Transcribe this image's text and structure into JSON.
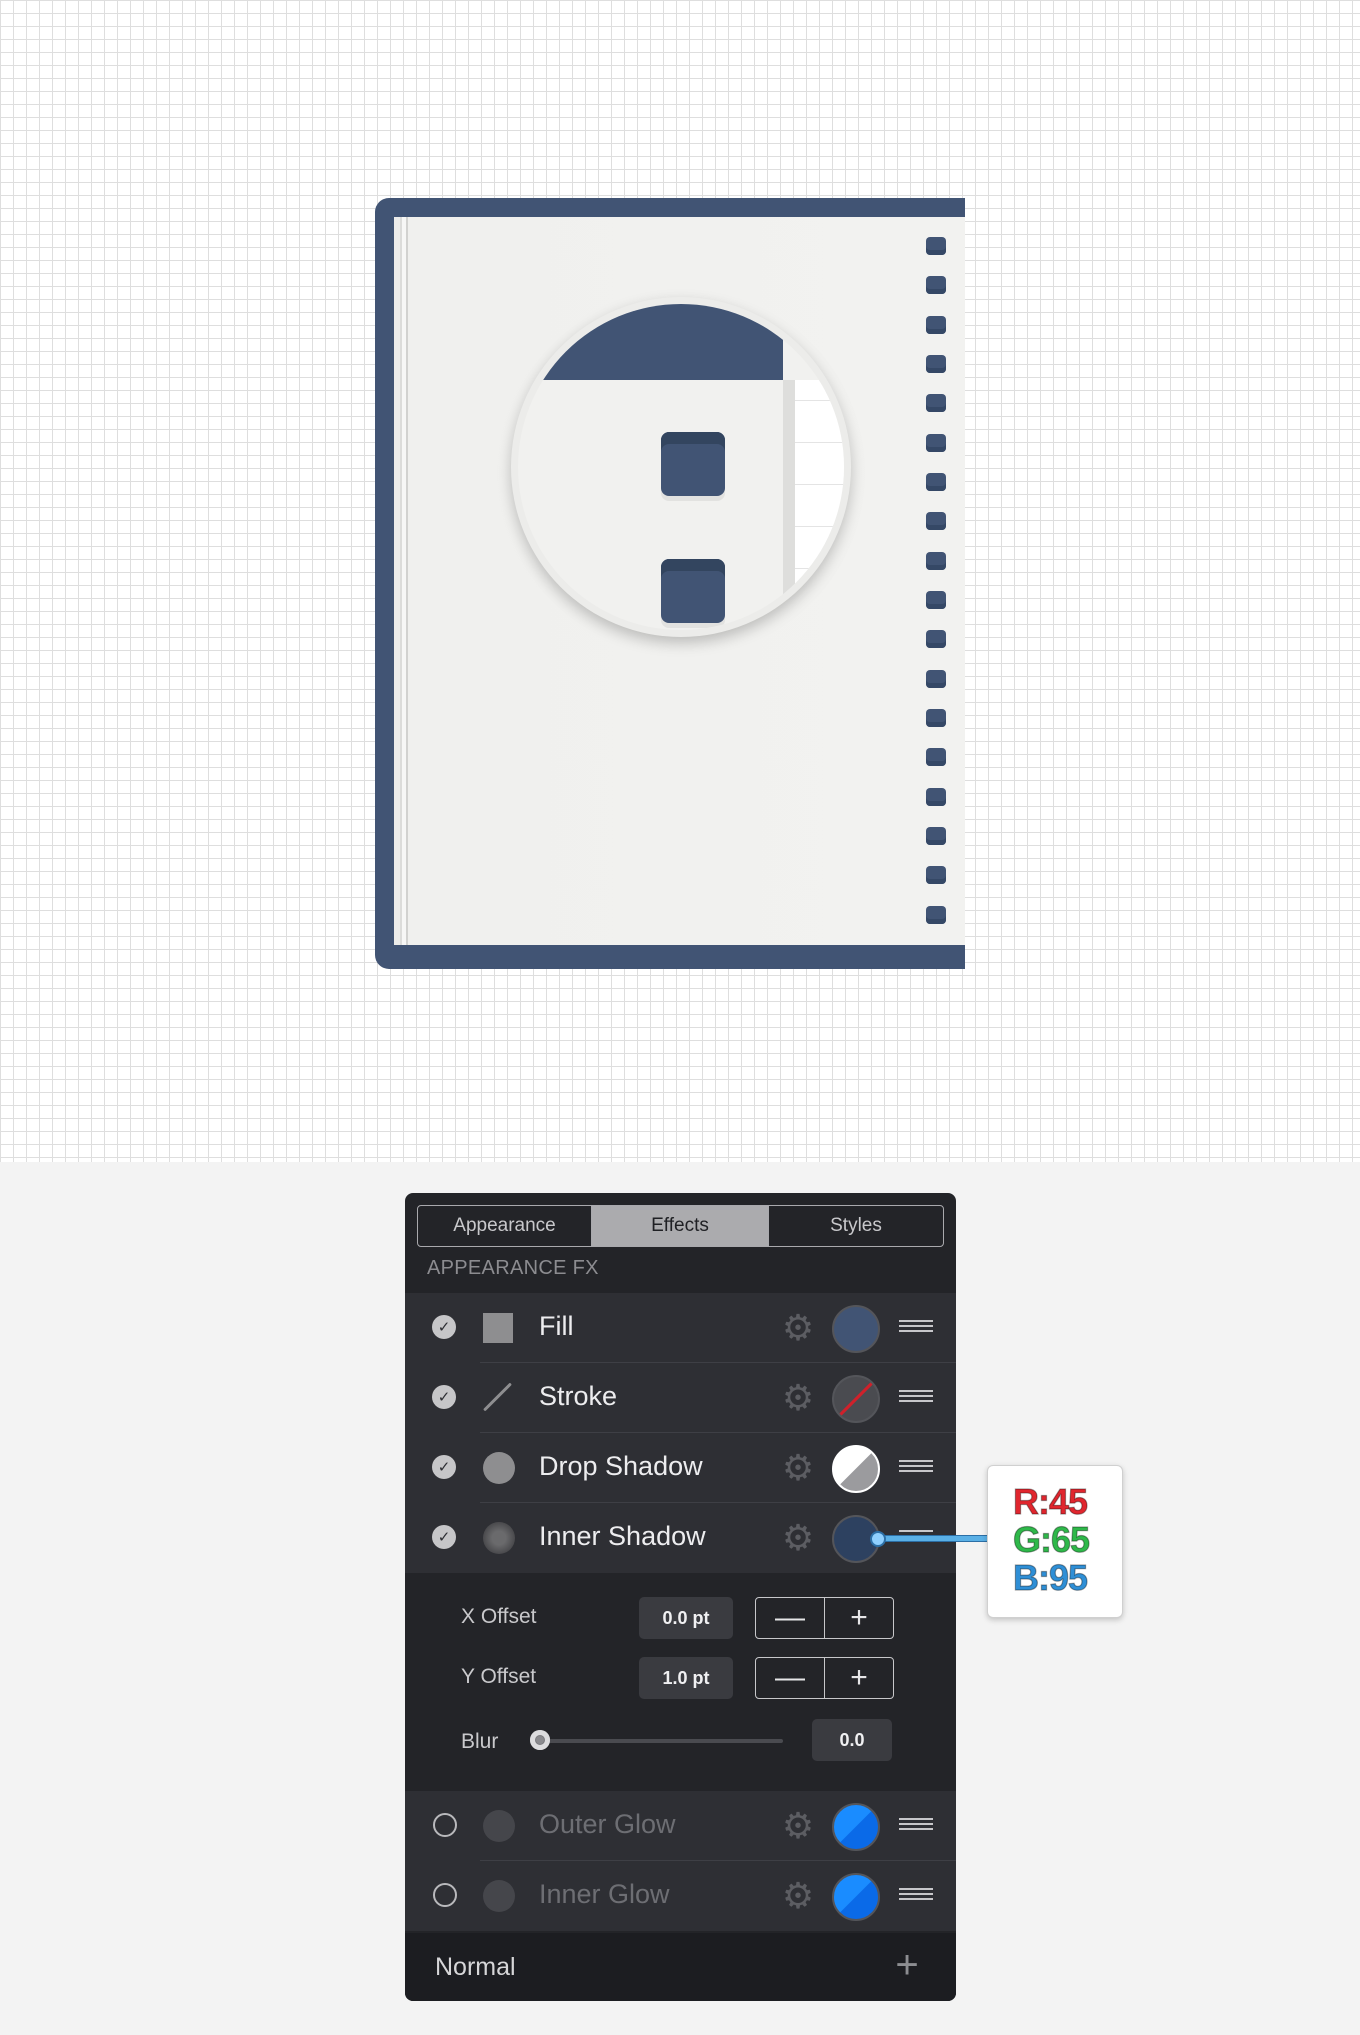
{
  "panel": {
    "tabs": [
      {
        "label": "Appearance",
        "active": false
      },
      {
        "label": "Effects",
        "active": true
      },
      {
        "label": "Styles",
        "active": false
      }
    ],
    "section_label": "APPEARANCE FX",
    "effects": [
      {
        "label": "Fill",
        "enabled": true,
        "icon": "fill-square-icon",
        "swatch_color": "#415474"
      },
      {
        "label": "Stroke",
        "enabled": true,
        "icon": "stroke-line-icon",
        "swatch_color": "none"
      },
      {
        "label": "Drop Shadow",
        "enabled": true,
        "icon": "drop-shadow-icon",
        "swatch_color": "#ffffff"
      },
      {
        "label": "Inner Shadow",
        "enabled": true,
        "icon": "inner-shadow-icon",
        "swatch_color": "#2d4160"
      },
      {
        "label": "Outer Glow",
        "enabled": false,
        "icon": "outer-glow-icon",
        "swatch_color": "#1a8cff"
      },
      {
        "label": "Inner Glow",
        "enabled": false,
        "icon": "inner-glow-icon",
        "swatch_color": "#1a8cff"
      }
    ],
    "inner_shadow_settings": {
      "x_offset_label": "X Offset",
      "x_offset_value": "0.0 pt",
      "y_offset_label": "Y Offset",
      "y_offset_value": "1.0 pt",
      "blur_label": "Blur",
      "blur_value": "0.0",
      "blur_slider_fraction": 0.0,
      "minus": "—",
      "plus": "+"
    },
    "blend_mode": "Normal",
    "add_symbol": "+"
  },
  "callout": {
    "r": "R:45",
    "g": "G:65",
    "b": "B:95",
    "r_color": "#e0262e",
    "g_color": "#2fb84a",
    "b_color": "#2f8fd6"
  },
  "colors": {
    "notebook_cover": "#415474",
    "panel_bg": "#232428",
    "row_bg": "#2e2f34"
  }
}
